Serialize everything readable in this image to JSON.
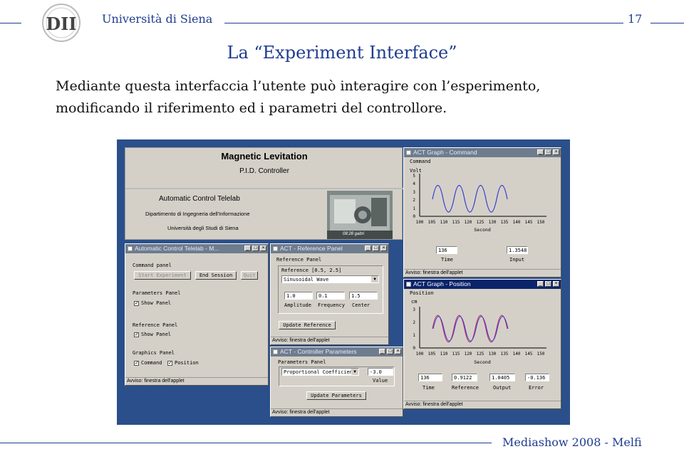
{
  "header": {
    "university": "Università di Siena",
    "page_number": "17",
    "logo_text": "DII"
  },
  "slide": {
    "title": "La “Experiment Interface”",
    "body_line1": "Mediante questa interfaccia l’utente può interagire con l’esperimento,",
    "body_line2": "modificando il riferimento ed i parametri del controllore."
  },
  "footer": {
    "text": "Mediashow 2008 - Melfi"
  },
  "app": {
    "banner": {
      "title": "Magnetic Levitation",
      "subtitle": "P.I.D. Controller"
    },
    "lab": {
      "name": "Automatic Control Telelab",
      "dept": "Dipartimento di Ingegneria dell'Informazione",
      "univ": "Università degli Studi di Siena",
      "cam_caption": "08:28 gabri"
    },
    "status_text": "Avviso: finestra dell'applet",
    "telelab_win": {
      "title": "Automatic Control Telelab - M...",
      "command_panel": "Command panel",
      "start_btn": "Start Experiment",
      "end_btn": "End Session",
      "quit_btn": "Quit",
      "params_panel": "Parameters Panel",
      "show_panel": "Show Panel",
      "ref_panel": "Reference Panel",
      "show_panel2": "Show Panel",
      "graphics_panel": "Graphics Panel",
      "command_chk": "Command",
      "position_chk": "Position"
    },
    "ref_win": {
      "title": "ACT - Reference Panel",
      "heading": "Reference Panel",
      "ref_label": "Reference [0.5, 2.5]",
      "wave_value": "Sinusoidal Wave",
      "amplitude_value": "1.0",
      "frequency_value": "0.1",
      "center_value": "1.5",
      "amplitude_label": "Amplitude",
      "frequency_label": "Frequency",
      "center_label": "Center",
      "update_btn": "Update Reference"
    },
    "ctrl_win": {
      "title": "ACT - Controller Parameters",
      "heading": "Parameters Panel",
      "param_value": "Proportional Coefficient",
      "param_field": "-3.0",
      "value_label": "Value",
      "update_btn": "Update Parameters"
    },
    "command_graph": {
      "title": "ACT Graph - Command",
      "heading": "Command",
      "unit": "Volt",
      "y_ticks": [
        "5",
        "4",
        "3",
        "2",
        "1",
        "0"
      ],
      "x_ticks": [
        "100",
        "105",
        "110",
        "115",
        "120",
        "125",
        "130",
        "135",
        "140",
        "145",
        "150"
      ],
      "x_label": "Second",
      "time_value": "136",
      "input_value": "1.3548",
      "time_label": "Time",
      "input_label": "Input"
    },
    "position_graph": {
      "title": "ACT Graph - Position",
      "heading": "Position",
      "unit": "cm",
      "y_ticks": [
        "3",
        "2",
        "1",
        "0"
      ],
      "x_ticks": [
        "100",
        "105",
        "110",
        "115",
        "120",
        "125",
        "130",
        "135",
        "140",
        "145",
        "150"
      ],
      "x_label": "Second",
      "time_value": "136",
      "reference_value": "0.9122",
      "output_value": "1.0405",
      "error_value": "-0.136",
      "time_label": "Time",
      "reference_label": "Reference",
      "output_label": "Output",
      "error_label": "Error"
    },
    "colors": {
      "command_wave": "#3b3bd0",
      "position_ref": "#c0306a",
      "position_out": "#3b3bd0",
      "titlebar_active": "#0a246a",
      "titlebar_inactive": "#6e7c8e"
    }
  }
}
